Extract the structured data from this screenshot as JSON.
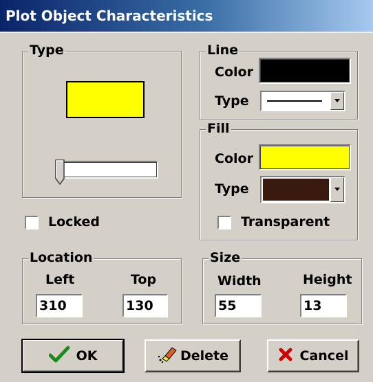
{
  "window": {
    "title": "Plot Object Characteristics"
  },
  "type_group": {
    "legend": "Type",
    "preview_color": "#ffff00",
    "slider_value": 0
  },
  "line_group": {
    "legend": "Line",
    "color_label": "Color",
    "color_value": "#000000",
    "type_label": "Type",
    "type_value": "solid"
  },
  "fill_group": {
    "legend": "Fill",
    "color_label": "Color",
    "color_value": "#ffff00",
    "type_label": "Type",
    "type_value": "#3a1a0e",
    "transparent_label": "Transparent",
    "transparent_checked": false
  },
  "locked": {
    "label": "Locked",
    "checked": false
  },
  "location_group": {
    "legend": "Location",
    "left_label": "Left",
    "left_value": "310",
    "top_label": "Top",
    "top_value": "130"
  },
  "size_group": {
    "legend": "Size",
    "width_label": "Width",
    "width_value": "55",
    "height_label": "Height",
    "height_value": "13"
  },
  "buttons": {
    "ok_label": "OK",
    "delete_label": "Delete",
    "cancel_label": "Cancel"
  },
  "icons": {
    "ok": "checkmark-icon",
    "delete": "eraser-icon",
    "cancel": "x-icon"
  },
  "colors": {
    "face": "#d4d0c8",
    "title_bar": "#0a246a",
    "ok_check": "#1a8a1a",
    "cancel_x": "#d00000"
  }
}
